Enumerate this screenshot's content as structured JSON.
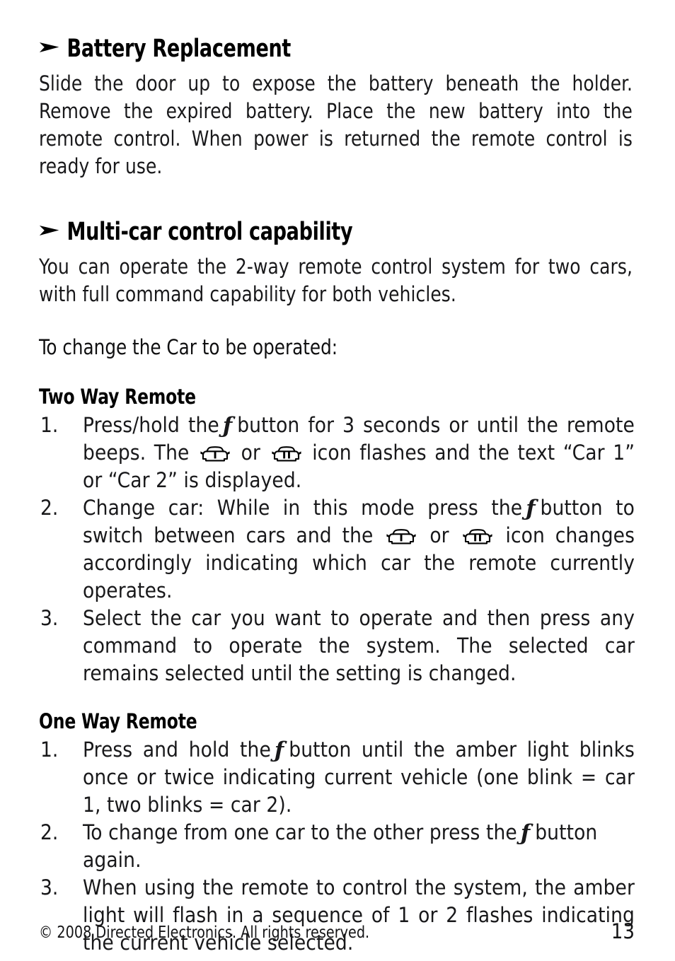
{
  "page": {
    "number": "13",
    "copyright": "© 2008 Directed Electronics. All rights reserved.",
    "bullet_glyph": "arrow-bullet",
    "background_color": "#ffffff",
    "text_color": "#000000"
  },
  "sections": {
    "battery": {
      "heading": "Battery Replacement",
      "paragraph": "Slide the door up to expose the battery beneath the holder.  Remove the expired battery. Place the new battery into the remote control. When power is returned the remote control is ready for use."
    },
    "multicar": {
      "heading": "Multi-car control capability",
      "paragraph": "You can operate the 2-way remote control system for two cars, with full command capability for both vehicles.",
      "lead_line": "To change the Car to be operated:"
    },
    "two_way": {
      "heading": "Two Way Remote",
      "items": [
        {
          "number": "1.",
          "part1": "Press/hold the",
          "f_symbol": "ƒ",
          "part2": "button for 3 seconds or until the remote beeps. The",
          "icon1": "car-one-icon",
          "part3": "or",
          "icon2": "car-two-icon",
          "part4": "icon flashes and the text “Car 1” or “Car 2” is displayed."
        },
        {
          "number": "2.",
          "part1": "Change car: While in this mode press the",
          "f_symbol": "ƒ",
          "part2": "button to switch between cars and the",
          "icon1": "car-one-icon",
          "part3": "or",
          "icon2": "car-two-icon",
          "part4": "icon changes accordingly indicating which car the remote currently operates."
        },
        {
          "number": "3.",
          "text": "Select the car you want to operate and then press any command to operate the system. The selected car remains selected until the setting is changed."
        }
      ]
    },
    "one_way": {
      "heading": "One Way Remote",
      "items": [
        {
          "number": "1.",
          "part1": "Press and hold the",
          "f_symbol": "ƒ",
          "part2": "button until the amber light blinks once or twice indicating current vehicle (one blink = car 1, two blinks = car 2)."
        },
        {
          "number": "2.",
          "part1": "To change from one car to the other press the",
          "f_symbol": "ƒ",
          "part2": "button again."
        },
        {
          "number": "3.",
          "text": "When using the remote to control the system, the amber light will flash in a sequence of 1 or 2 flashes indicating the current vehicle selected."
        }
      ]
    }
  }
}
